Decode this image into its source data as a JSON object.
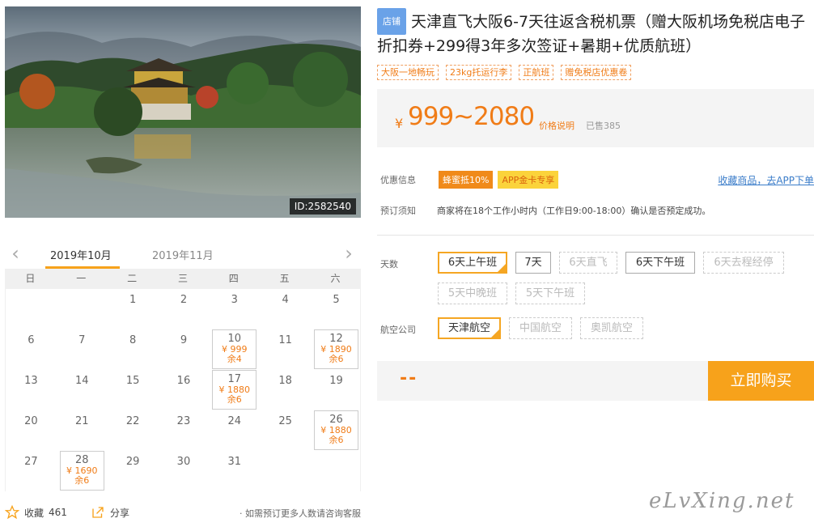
{
  "photo": {
    "id_label": "ID:2582540"
  },
  "calendar": {
    "prev_arrow": "‹",
    "next_arrow": "›",
    "month_active": "2019年10月",
    "month_next": "2019年11月",
    "weekdays": [
      "日",
      "一",
      "二",
      "三",
      "四",
      "五",
      "六"
    ],
    "days": [
      {
        "day": ""
      },
      {
        "day": ""
      },
      {
        "day": "1"
      },
      {
        "day": "2"
      },
      {
        "day": "3"
      },
      {
        "day": "4"
      },
      {
        "day": "5"
      },
      {
        "day": "6"
      },
      {
        "day": "7"
      },
      {
        "day": "8"
      },
      {
        "day": "9"
      },
      {
        "day": "10",
        "price": "¥ 999",
        "stock": "余4"
      },
      {
        "day": "11"
      },
      {
        "day": "12",
        "price": "¥ 1890",
        "stock": "余6"
      },
      {
        "day": "13"
      },
      {
        "day": "14"
      },
      {
        "day": "15"
      },
      {
        "day": "16"
      },
      {
        "day": "17",
        "price": "¥ 1880",
        "stock": "余6"
      },
      {
        "day": "18"
      },
      {
        "day": "19"
      },
      {
        "day": "20"
      },
      {
        "day": "21"
      },
      {
        "day": "22"
      },
      {
        "day": "23"
      },
      {
        "day": "24"
      },
      {
        "day": "25"
      },
      {
        "day": "26",
        "price": "¥ 1880",
        "stock": "余6"
      },
      {
        "day": "27"
      },
      {
        "day": "28",
        "price": "¥ 1690",
        "stock": "余6"
      },
      {
        "day": "29"
      },
      {
        "day": "30"
      },
      {
        "day": "31"
      }
    ],
    "favorite_label": "收藏",
    "favorite_count": "461",
    "share_label": "分享",
    "note": "· 如需预订更多人数请咨询客服"
  },
  "product": {
    "shop_tag": "店铺",
    "title": "天津直飞大阪6-7天往返含税机票（赠大阪机场免税店电子折扣券+299得3年多次签证+暑期+优质航班）",
    "tags": [
      "大阪一地畅玩",
      "23kg托运行李",
      "正航班",
      "赠免税店优惠卷"
    ],
    "currency": "¥",
    "price": "999~2080",
    "price_explain": "价格说明",
    "sold": "已售385"
  },
  "promo": {
    "label": "优惠信息",
    "badge1": "蜂蜜抵10%",
    "badge2": "APP金卡专享",
    "link": "收藏商品，去APP下单"
  },
  "notice": {
    "label": "预订须知",
    "text": "商家将在18个工作小时内（工作日9:00-18:00）确认是否预定成功。"
  },
  "options": {
    "days_label": "天数",
    "days": [
      {
        "label": "6天上午班",
        "state": "selected"
      },
      {
        "label": "7天",
        "state": "normal"
      },
      {
        "label": "6天直飞",
        "state": "disabled"
      },
      {
        "label": "6天下午班",
        "state": "normal"
      },
      {
        "label": "6天去程经停",
        "state": "disabled"
      },
      {
        "label": "5天中晚班",
        "state": "disabled"
      },
      {
        "label": "5天下午班",
        "state": "disabled"
      }
    ],
    "airline_label": "航空公司",
    "airlines": [
      {
        "label": "天津航空",
        "state": "selected"
      },
      {
        "label": "中国航空",
        "state": "disabled"
      },
      {
        "label": "奥凯航空",
        "state": "disabled"
      }
    ]
  },
  "buy": {
    "total": "--",
    "button": "立即购买"
  },
  "watermark": "eLvXing.net",
  "colors": {
    "accent": "#f7a21b",
    "price": "#f07c17",
    "link": "#3a7cc9",
    "shop_tag": "#6aa2e8"
  }
}
